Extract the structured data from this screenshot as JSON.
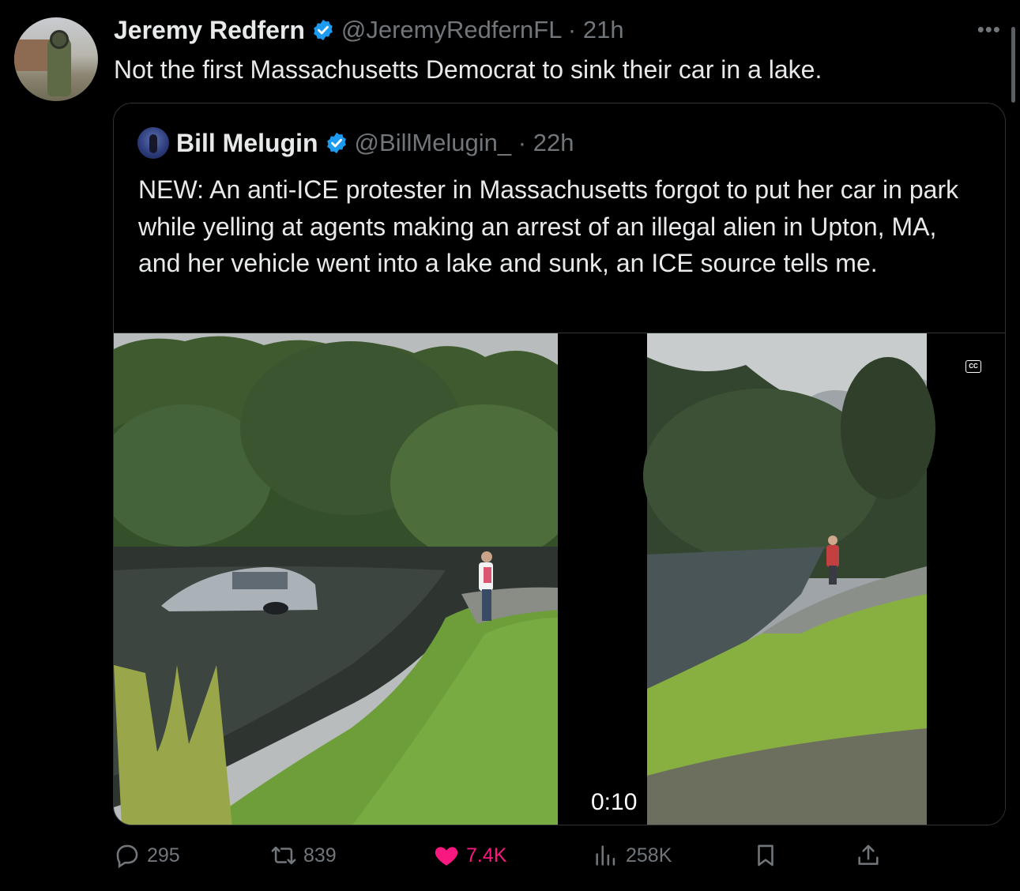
{
  "post": {
    "author_name": "Jeremy Redfern",
    "handle": "@JeremyRedfernFL",
    "time": "21h",
    "text": "Not the first Massachusetts Democrat to sink their car in a lake."
  },
  "quoted_post": {
    "author_name": "Bill Melugin",
    "handle": "@BillMelugin_",
    "time": "22h",
    "text": "NEW: An anti-ICE protester in Massachusetts forgot to put her car in park while yelling at agents making an arrest of an illegal alien in Upton, MA, and her vehicle went into a lake and sunk, an ICE source tells me.",
    "video": {
      "duration": "0:10",
      "cc_label": "CC"
    }
  },
  "actions": {
    "replies": "295",
    "reposts": "839",
    "likes": "7.4K",
    "views": "258K"
  },
  "icons": {
    "more": "more-horizontal-icon",
    "verified": "verified-badge-icon",
    "reply": "reply-icon",
    "repost": "repost-icon",
    "like": "heart-icon",
    "views": "views-icon",
    "bookmark": "bookmark-icon",
    "share": "share-icon"
  },
  "colors": {
    "background": "#000000",
    "text": "#e7e9ea",
    "muted": "#71767b",
    "verified": "#1d9bf0",
    "like": "#f91880",
    "border": "#2f3336"
  }
}
